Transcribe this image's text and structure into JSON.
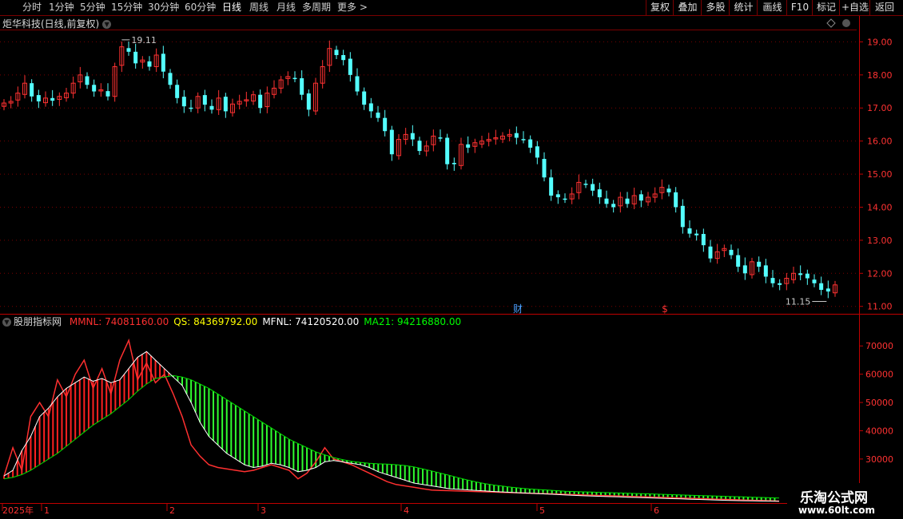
{
  "toolbar": {
    "periods": [
      {
        "label": "分时"
      },
      {
        "label": "1分钟"
      },
      {
        "label": "5分钟"
      },
      {
        "label": "15分钟"
      },
      {
        "label": "30分钟"
      },
      {
        "label": "60分钟"
      },
      {
        "label": "日线"
      },
      {
        "label": "周线"
      },
      {
        "label": "月线"
      },
      {
        "label": "多周期"
      },
      {
        "label": "更多"
      }
    ],
    "active_period": "日线",
    "buttons": [
      {
        "label": "复权"
      },
      {
        "label": "叠加"
      },
      {
        "label": "多股"
      },
      {
        "label": "统计"
      },
      {
        "label": "画线"
      },
      {
        "label": "F10"
      },
      {
        "label": "标记"
      },
      {
        "label": "+自选"
      },
      {
        "label": "返回"
      }
    ]
  },
  "stock": {
    "title": "炬华科技(日线,前复权)"
  },
  "indicator": {
    "name": "股朋指标网",
    "readouts": [
      {
        "text": "MMNL: 74081160.00",
        "color": "#ff3030"
      },
      {
        "text": "QS: 84369792.00",
        "color": "#ffff00"
      },
      {
        "text": "MFNL: 74120520.00",
        "color": "#ffffff"
      },
      {
        "text": "MA21: 94216880.00",
        "color": "#00ff00"
      }
    ]
  },
  "markers": {
    "high_label": "19.11",
    "low_label": "11.15",
    "news1": "财",
    "news2": "$"
  },
  "time_axis": {
    "labels": [
      "2025年",
      "1",
      "2",
      "3",
      "4",
      "5",
      "6"
    ]
  },
  "colors": {
    "up": "#ff3232",
    "down": "#54ffff",
    "grid": "#7a0000",
    "axis": "#c00000",
    "ma21": "#00e000",
    "mfnl": "#ffffff"
  },
  "watermark": {
    "title": "乐淘公式网",
    "url": "www.60lt.com"
  },
  "chart_data": [
    {
      "type": "candlestick",
      "title": "炬华科技(日线,前复权)",
      "ylim": [
        10.8,
        19.3
      ],
      "y_ticks": [
        11.0,
        12.0,
        13.0,
        14.0,
        15.0,
        16.0,
        17.0,
        18.0,
        19.0
      ],
      "close": [
        17.15,
        17.2,
        17.45,
        17.75,
        17.35,
        17.2,
        17.3,
        17.22,
        17.35,
        17.45,
        17.75,
        18.0,
        17.7,
        17.5,
        17.55,
        17.35,
        18.25,
        18.85,
        18.7,
        18.35,
        18.45,
        18.25,
        18.6,
        18.1,
        17.7,
        17.3,
        17.05,
        17.0,
        17.35,
        17.1,
        16.95,
        17.3,
        16.9,
        17.12,
        17.2,
        17.25,
        17.4,
        17.0,
        17.45,
        17.6,
        17.85,
        17.95,
        17.9,
        17.4,
        16.95,
        17.75,
        18.25,
        18.8,
        18.6,
        18.45,
        18.0,
        17.5,
        17.1,
        16.9,
        16.7,
        16.3,
        15.6,
        16.05,
        16.2,
        16.05,
        15.7,
        15.85,
        16.15,
        16.1,
        15.3,
        15.3,
        15.9,
        15.8,
        15.95,
        16.0,
        16.05,
        16.1,
        16.15,
        16.2,
        16.1,
        16.05,
        15.8,
        15.5,
        14.9,
        14.35,
        14.3,
        14.25,
        14.4,
        14.75,
        14.7,
        14.5,
        14.3,
        14.1,
        14.0,
        14.3,
        14.1,
        14.35,
        14.2,
        14.3,
        14.4,
        14.6,
        14.45,
        14.0,
        13.4,
        13.2,
        13.15,
        12.85,
        12.45,
        12.65,
        12.75,
        12.55,
        12.2,
        12.0,
        12.35,
        12.2,
        11.9,
        11.7,
        11.65,
        11.85,
        12.0,
        11.95,
        11.85,
        11.7,
        11.5,
        11.45,
        11.65
      ],
      "series_markers": [
        {
          "label": "19.11",
          "value": 19.11
        },
        {
          "label": "11.15",
          "value": 11.15
        }
      ]
    },
    {
      "type": "line",
      "title": "股朋指标网",
      "ylim": [
        15000,
        76000
      ],
      "y_ticks": [
        20000,
        30000,
        40000,
        50000,
        60000,
        70000
      ],
      "series": [
        {
          "name": "MMNL",
          "color": "#ff3030",
          "values": [
            24000,
            34000,
            26000,
            45000,
            50000,
            45000,
            58000,
            52000,
            60000,
            65000,
            55000,
            62000,
            53000,
            65000,
            72000,
            58000,
            64000,
            57000,
            60000,
            53000,
            45000,
            35000,
            31000,
            28000,
            27000,
            26500,
            26000,
            25500,
            26000,
            27000,
            28000,
            27000,
            26000,
            23000,
            25000,
            29000,
            34000,
            30000,
            29000,
            28000,
            26500,
            25000,
            23500,
            22000,
            21000,
            20500,
            20000,
            19500,
            19000,
            18900,
            18800,
            18700,
            18600,
            18500,
            18400,
            18300,
            18200,
            18100,
            18000,
            17900,
            17800,
            17700,
            17600,
            17500,
            17400,
            17300,
            17200,
            17100,
            17000,
            16900,
            16800,
            16700,
            16600,
            16500,
            16400,
            16300,
            16200,
            16100,
            16000,
            15900,
            15800,
            15700,
            15600,
            15500,
            15400,
            15300,
            15200,
            15100
          ]
        },
        {
          "name": "MFNL",
          "color": "#ffffff",
          "values": [
            24000,
            26000,
            33000,
            38000,
            45000,
            48000,
            52000,
            55000,
            57000,
            59000,
            57500,
            58500,
            57000,
            58000,
            62000,
            66000,
            68000,
            65000,
            62000,
            59000,
            56000,
            50000,
            43000,
            38000,
            35000,
            32000,
            30000,
            28000,
            27000,
            27500,
            28500,
            28000,
            27000,
            25500,
            26000,
            27000,
            29000,
            29500,
            29000,
            28500,
            28000,
            27000,
            25500,
            24500,
            23500,
            22500,
            21500,
            21000,
            20500,
            20000,
            19500,
            19300,
            19100,
            18900,
            18700,
            18500,
            18350,
            18200,
            18050,
            17900,
            17750,
            17600,
            17450,
            17300,
            17150,
            17000,
            16900,
            16800,
            16700,
            16600,
            16500,
            16400,
            16300,
            16200,
            16100,
            16000,
            15900,
            15800,
            15700,
            15600,
            15500,
            15400,
            15300,
            15250,
            15200,
            15150,
            15100,
            15050
          ]
        },
        {
          "name": "MA21",
          "color": "#00e000",
          "values": [
            23000,
            23500,
            24500,
            26000,
            28000,
            30000,
            32000,
            34500,
            37000,
            39500,
            42000,
            44000,
            46000,
            48500,
            51000,
            54000,
            56500,
            58500,
            59000,
            59500,
            59000,
            58000,
            56500,
            55000,
            53000,
            51000,
            49000,
            47000,
            45000,
            43000,
            41000,
            39000,
            37000,
            35500,
            34000,
            32500,
            31500,
            30500,
            29800,
            29200,
            28800,
            28500,
            28300,
            28200,
            28000,
            27700,
            27200,
            26500,
            25800,
            25000,
            24200,
            23400,
            22600,
            21900,
            21300,
            20800,
            20400,
            20000,
            19700,
            19400,
            19200,
            19000,
            18800,
            18600,
            18500,
            18400,
            18300,
            18200,
            18100,
            18000,
            17900,
            17800,
            17700,
            17600,
            17500,
            17400,
            17300,
            17200,
            17100,
            17000,
            16900,
            16800,
            16700,
            16600,
            16500,
            16400,
            16300,
            16200
          ]
        }
      ]
    }
  ]
}
